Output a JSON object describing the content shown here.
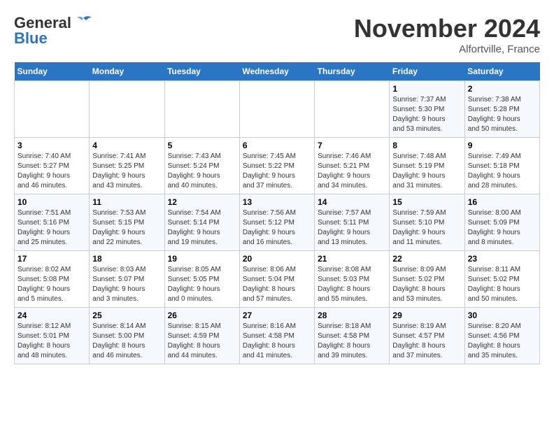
{
  "header": {
    "logo_general": "General",
    "logo_blue": "Blue",
    "month": "November 2024",
    "location": "Alfortville, France"
  },
  "days_of_week": [
    "Sunday",
    "Monday",
    "Tuesday",
    "Wednesday",
    "Thursday",
    "Friday",
    "Saturday"
  ],
  "weeks": [
    [
      {
        "day": "",
        "info": ""
      },
      {
        "day": "",
        "info": ""
      },
      {
        "day": "",
        "info": ""
      },
      {
        "day": "",
        "info": ""
      },
      {
        "day": "",
        "info": ""
      },
      {
        "day": "1",
        "info": "Sunrise: 7:37 AM\nSunset: 5:30 PM\nDaylight: 9 hours\nand 53 minutes."
      },
      {
        "day": "2",
        "info": "Sunrise: 7:38 AM\nSunset: 5:28 PM\nDaylight: 9 hours\nand 50 minutes."
      }
    ],
    [
      {
        "day": "3",
        "info": "Sunrise: 7:40 AM\nSunset: 5:27 PM\nDaylight: 9 hours\nand 46 minutes."
      },
      {
        "day": "4",
        "info": "Sunrise: 7:41 AM\nSunset: 5:25 PM\nDaylight: 9 hours\nand 43 minutes."
      },
      {
        "day": "5",
        "info": "Sunrise: 7:43 AM\nSunset: 5:24 PM\nDaylight: 9 hours\nand 40 minutes."
      },
      {
        "day": "6",
        "info": "Sunrise: 7:45 AM\nSunset: 5:22 PM\nDaylight: 9 hours\nand 37 minutes."
      },
      {
        "day": "7",
        "info": "Sunrise: 7:46 AM\nSunset: 5:21 PM\nDaylight: 9 hours\nand 34 minutes."
      },
      {
        "day": "8",
        "info": "Sunrise: 7:48 AM\nSunset: 5:19 PM\nDaylight: 9 hours\nand 31 minutes."
      },
      {
        "day": "9",
        "info": "Sunrise: 7:49 AM\nSunset: 5:18 PM\nDaylight: 9 hours\nand 28 minutes."
      }
    ],
    [
      {
        "day": "10",
        "info": "Sunrise: 7:51 AM\nSunset: 5:16 PM\nDaylight: 9 hours\nand 25 minutes."
      },
      {
        "day": "11",
        "info": "Sunrise: 7:53 AM\nSunset: 5:15 PM\nDaylight: 9 hours\nand 22 minutes."
      },
      {
        "day": "12",
        "info": "Sunrise: 7:54 AM\nSunset: 5:14 PM\nDaylight: 9 hours\nand 19 minutes."
      },
      {
        "day": "13",
        "info": "Sunrise: 7:56 AM\nSunset: 5:12 PM\nDaylight: 9 hours\nand 16 minutes."
      },
      {
        "day": "14",
        "info": "Sunrise: 7:57 AM\nSunset: 5:11 PM\nDaylight: 9 hours\nand 13 minutes."
      },
      {
        "day": "15",
        "info": "Sunrise: 7:59 AM\nSunset: 5:10 PM\nDaylight: 9 hours\nand 11 minutes."
      },
      {
        "day": "16",
        "info": "Sunrise: 8:00 AM\nSunset: 5:09 PM\nDaylight: 9 hours\nand 8 minutes."
      }
    ],
    [
      {
        "day": "17",
        "info": "Sunrise: 8:02 AM\nSunset: 5:08 PM\nDaylight: 9 hours\nand 5 minutes."
      },
      {
        "day": "18",
        "info": "Sunrise: 8:03 AM\nSunset: 5:07 PM\nDaylight: 9 hours\nand 3 minutes."
      },
      {
        "day": "19",
        "info": "Sunrise: 8:05 AM\nSunset: 5:05 PM\nDaylight: 9 hours\nand 0 minutes."
      },
      {
        "day": "20",
        "info": "Sunrise: 8:06 AM\nSunset: 5:04 PM\nDaylight: 8 hours\nand 57 minutes."
      },
      {
        "day": "21",
        "info": "Sunrise: 8:08 AM\nSunset: 5:03 PM\nDaylight: 8 hours\nand 55 minutes."
      },
      {
        "day": "22",
        "info": "Sunrise: 8:09 AM\nSunset: 5:02 PM\nDaylight: 8 hours\nand 53 minutes."
      },
      {
        "day": "23",
        "info": "Sunrise: 8:11 AM\nSunset: 5:02 PM\nDaylight: 8 hours\nand 50 minutes."
      }
    ],
    [
      {
        "day": "24",
        "info": "Sunrise: 8:12 AM\nSunset: 5:01 PM\nDaylight: 8 hours\nand 48 minutes."
      },
      {
        "day": "25",
        "info": "Sunrise: 8:14 AM\nSunset: 5:00 PM\nDaylight: 8 hours\nand 46 minutes."
      },
      {
        "day": "26",
        "info": "Sunrise: 8:15 AM\nSunset: 4:59 PM\nDaylight: 8 hours\nand 44 minutes."
      },
      {
        "day": "27",
        "info": "Sunrise: 8:16 AM\nSunset: 4:58 PM\nDaylight: 8 hours\nand 41 minutes."
      },
      {
        "day": "28",
        "info": "Sunrise: 8:18 AM\nSunset: 4:58 PM\nDaylight: 8 hours\nand 39 minutes."
      },
      {
        "day": "29",
        "info": "Sunrise: 8:19 AM\nSunset: 4:57 PM\nDaylight: 8 hours\nand 37 minutes."
      },
      {
        "day": "30",
        "info": "Sunrise: 8:20 AM\nSunset: 4:56 PM\nDaylight: 8 hours\nand 35 minutes."
      }
    ]
  ]
}
